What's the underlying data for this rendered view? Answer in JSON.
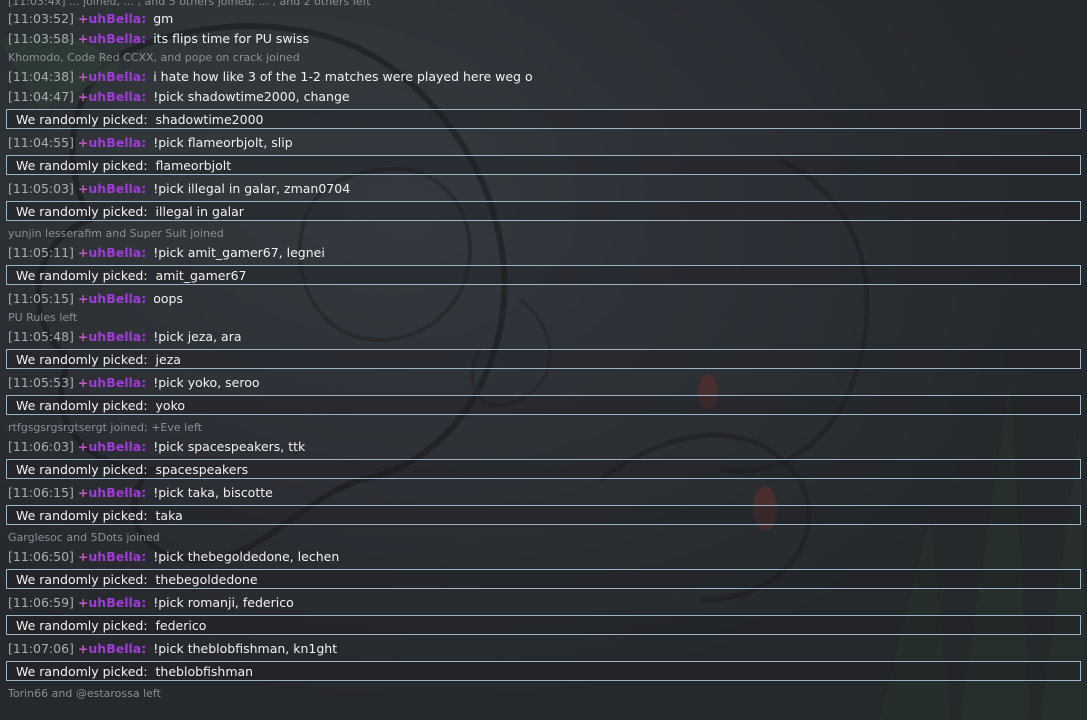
{
  "top_cut": "[11:03:4x] ... joined, ... , and 5 others joined; ... , and 2 others left",
  "rows": [
    {
      "type": "chat",
      "ts": "[11:03:52]",
      "user": "uhBella:",
      "msg": "gm"
    },
    {
      "type": "chat",
      "ts": "[11:03:58]",
      "user": "uhBella:",
      "msg": "its flips time for PU swiss"
    },
    {
      "type": "notice",
      "text": "Khomodo, Code Red CCXX, and pope on crack joined"
    },
    {
      "type": "chat",
      "ts": "[11:04:38]",
      "user": "uhBella:",
      "msg": "i hate how like 3 of the 1-2 matches were played here weg o"
    },
    {
      "type": "chat",
      "ts": "[11:04:47]",
      "user": "uhBella:",
      "msg": "!pick shadowtime2000, change"
    },
    {
      "type": "pick",
      "label": "We randomly picked:",
      "value": "shadowtime2000"
    },
    {
      "type": "chat",
      "ts": "[11:04:55]",
      "user": "uhBella:",
      "msg": "!pick flameorbjolt, slip"
    },
    {
      "type": "pick",
      "label": "We randomly picked:",
      "value": "flameorbjolt"
    },
    {
      "type": "chat",
      "ts": "[11:05:03]",
      "user": "uhBella:",
      "msg": "!pick illegal in galar, zman0704"
    },
    {
      "type": "pick",
      "label": "We randomly picked:",
      "value": "illegal in galar"
    },
    {
      "type": "notice",
      "text": "yunjin lesserafim and Super Suit joined"
    },
    {
      "type": "chat",
      "ts": "[11:05:11]",
      "user": "uhBella:",
      "msg": "!pick amit_gamer67, legnei"
    },
    {
      "type": "pick",
      "label": "We randomly picked:",
      "value": "amit_gamer67"
    },
    {
      "type": "chat",
      "ts": "[11:05:15]",
      "user": "uhBella:",
      "msg": "oops"
    },
    {
      "type": "notice",
      "text": "PU Rules left"
    },
    {
      "type": "chat",
      "ts": "[11:05:48]",
      "user": "uhBella:",
      "msg": "!pick jeza, ara"
    },
    {
      "type": "pick",
      "label": "We randomly picked:",
      "value": "jeza"
    },
    {
      "type": "chat",
      "ts": "[11:05:53]",
      "user": "uhBella:",
      "msg": "!pick yoko, seroo"
    },
    {
      "type": "pick",
      "label": "We randomly picked:",
      "value": "yoko"
    },
    {
      "type": "notice",
      "text": "rtfgsgsrgsrgtsergt joined; +Eve left"
    },
    {
      "type": "chat",
      "ts": "[11:06:03]",
      "user": "uhBella:",
      "msg": "!pick spacespeakers, ttk"
    },
    {
      "type": "pick",
      "label": "We randomly picked:",
      "value": "spacespeakers"
    },
    {
      "type": "chat",
      "ts": "[11:06:15]",
      "user": "uhBella:",
      "msg": "!pick taka, biscotte"
    },
    {
      "type": "pick",
      "label": "We randomly picked:",
      "value": "taka"
    },
    {
      "type": "notice",
      "text": "Garglesoc and 5Dots joined"
    },
    {
      "type": "chat",
      "ts": "[11:06:50]",
      "user": "uhBella:",
      "msg": "!pick thebegoldedone, lechen"
    },
    {
      "type": "pick",
      "label": "We randomly picked:",
      "value": "thebegoldedone"
    },
    {
      "type": "chat",
      "ts": "[11:06:59]",
      "user": "uhBella:",
      "msg": "!pick romanji, federico"
    },
    {
      "type": "pick",
      "label": "We randomly picked:",
      "value": "federico"
    },
    {
      "type": "chat",
      "ts": "[11:07:06]",
      "user": "uhBella:",
      "msg": "!pick theblobfishman, kn1ght"
    },
    {
      "type": "pick",
      "label": "We randomly picked:",
      "value": "theblobfishman"
    },
    {
      "type": "notice",
      "text": "Torin66 and @estarossa left"
    }
  ],
  "rank_symbol": "+",
  "colors": {
    "username": "#a03cd6",
    "rank": "#c05ac2",
    "timestamp": "#a9adb3",
    "notice": "#8a8f96",
    "pick_border": "#9bb6c8"
  }
}
